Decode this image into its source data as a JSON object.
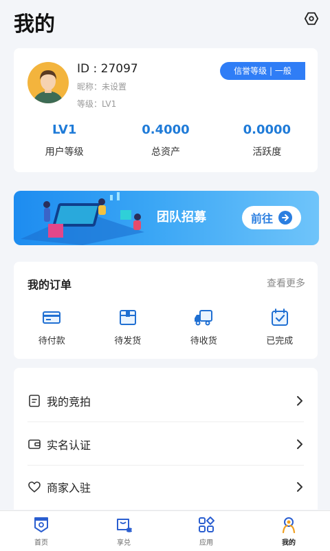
{
  "header": {
    "title": "我的"
  },
  "profile": {
    "id_text": "ID : 27097",
    "nickname": "昵称：未设置",
    "level": "等级：LV1",
    "credit_badge": "信誉等级 | 一般",
    "stats": [
      {
        "value": "LV1",
        "label": "用户等级"
      },
      {
        "value": "0.4000",
        "label": "总资产"
      },
      {
        "value": "0.0000",
        "label": "活跃度"
      }
    ]
  },
  "banner": {
    "title": "团队招募",
    "button_label": "前往"
  },
  "orders": {
    "title": "我的订单",
    "more_label": "查看更多",
    "items": [
      {
        "label": "待付款",
        "icon": "card-icon"
      },
      {
        "label": "待发货",
        "icon": "package-icon"
      },
      {
        "label": "待收货",
        "icon": "truck-icon"
      },
      {
        "label": "已完成",
        "icon": "completed-icon"
      }
    ]
  },
  "menu": {
    "items": [
      {
        "label": "我的竞拍",
        "icon": "auction-icon"
      },
      {
        "label": "实名认证",
        "icon": "wallet-icon"
      },
      {
        "label": "商家入驻",
        "icon": "heart-icon"
      }
    ]
  },
  "tabbar": {
    "items": [
      {
        "label": "首页",
        "icon": "home-shield-icon"
      },
      {
        "label": "享兑",
        "icon": "exchange-icon"
      },
      {
        "label": "应用",
        "icon": "apps-grid-icon"
      },
      {
        "label": "我的",
        "icon": "profile-icon",
        "active": true
      }
    ]
  },
  "colors": {
    "accent": "#2f7df6",
    "stat_value": "#1f7bd8",
    "background": "#f3f5f9"
  }
}
